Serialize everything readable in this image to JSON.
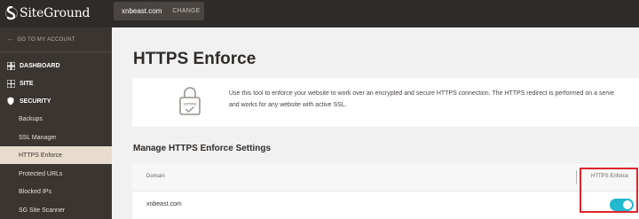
{
  "header": {
    "logo_text": "SiteGround",
    "domain": "xnbeast.com",
    "change_label": "CHANGE"
  },
  "sidebar": {
    "back_label": "GO TO MY ACCOUNT",
    "sections": [
      {
        "label": "DASHBOARD",
        "icon": "dashboard-grid-icon"
      },
      {
        "label": "SITE",
        "icon": "site-grid-icon"
      },
      {
        "label": "SECURITY",
        "icon": "shield-icon"
      }
    ],
    "security_items": [
      {
        "label": "Backups"
      },
      {
        "label": "SSL Manager"
      },
      {
        "label": "HTTPS Enforce",
        "active": true
      },
      {
        "label": "Protected URLs"
      },
      {
        "label": "Blocked IPs"
      },
      {
        "label": "SG Site Scanner"
      }
    ]
  },
  "main": {
    "title": "HTTPS Enforce",
    "info_icon_label": "HTTPS",
    "info_line1": "Use this tool to enforce your website to work over an encrypted and secure HTTPS connection. The HTTPS redirect is performed on a serve",
    "info_line2": "and works for any website with active SSL.",
    "section_title": "Manage HTTPS Enforce Settings",
    "table": {
      "col_domain": "Domain",
      "col_https": "HTTPS Enforce",
      "rows": [
        {
          "domain": "xnbeast.com",
          "https_enforce": true
        }
      ]
    }
  },
  "colors": {
    "topbar": "#2f2b28",
    "sidebar": "#3a3531",
    "active_item": "#e8dccd",
    "toggle_on": "#22b8cf",
    "highlight": "#e0242b"
  }
}
